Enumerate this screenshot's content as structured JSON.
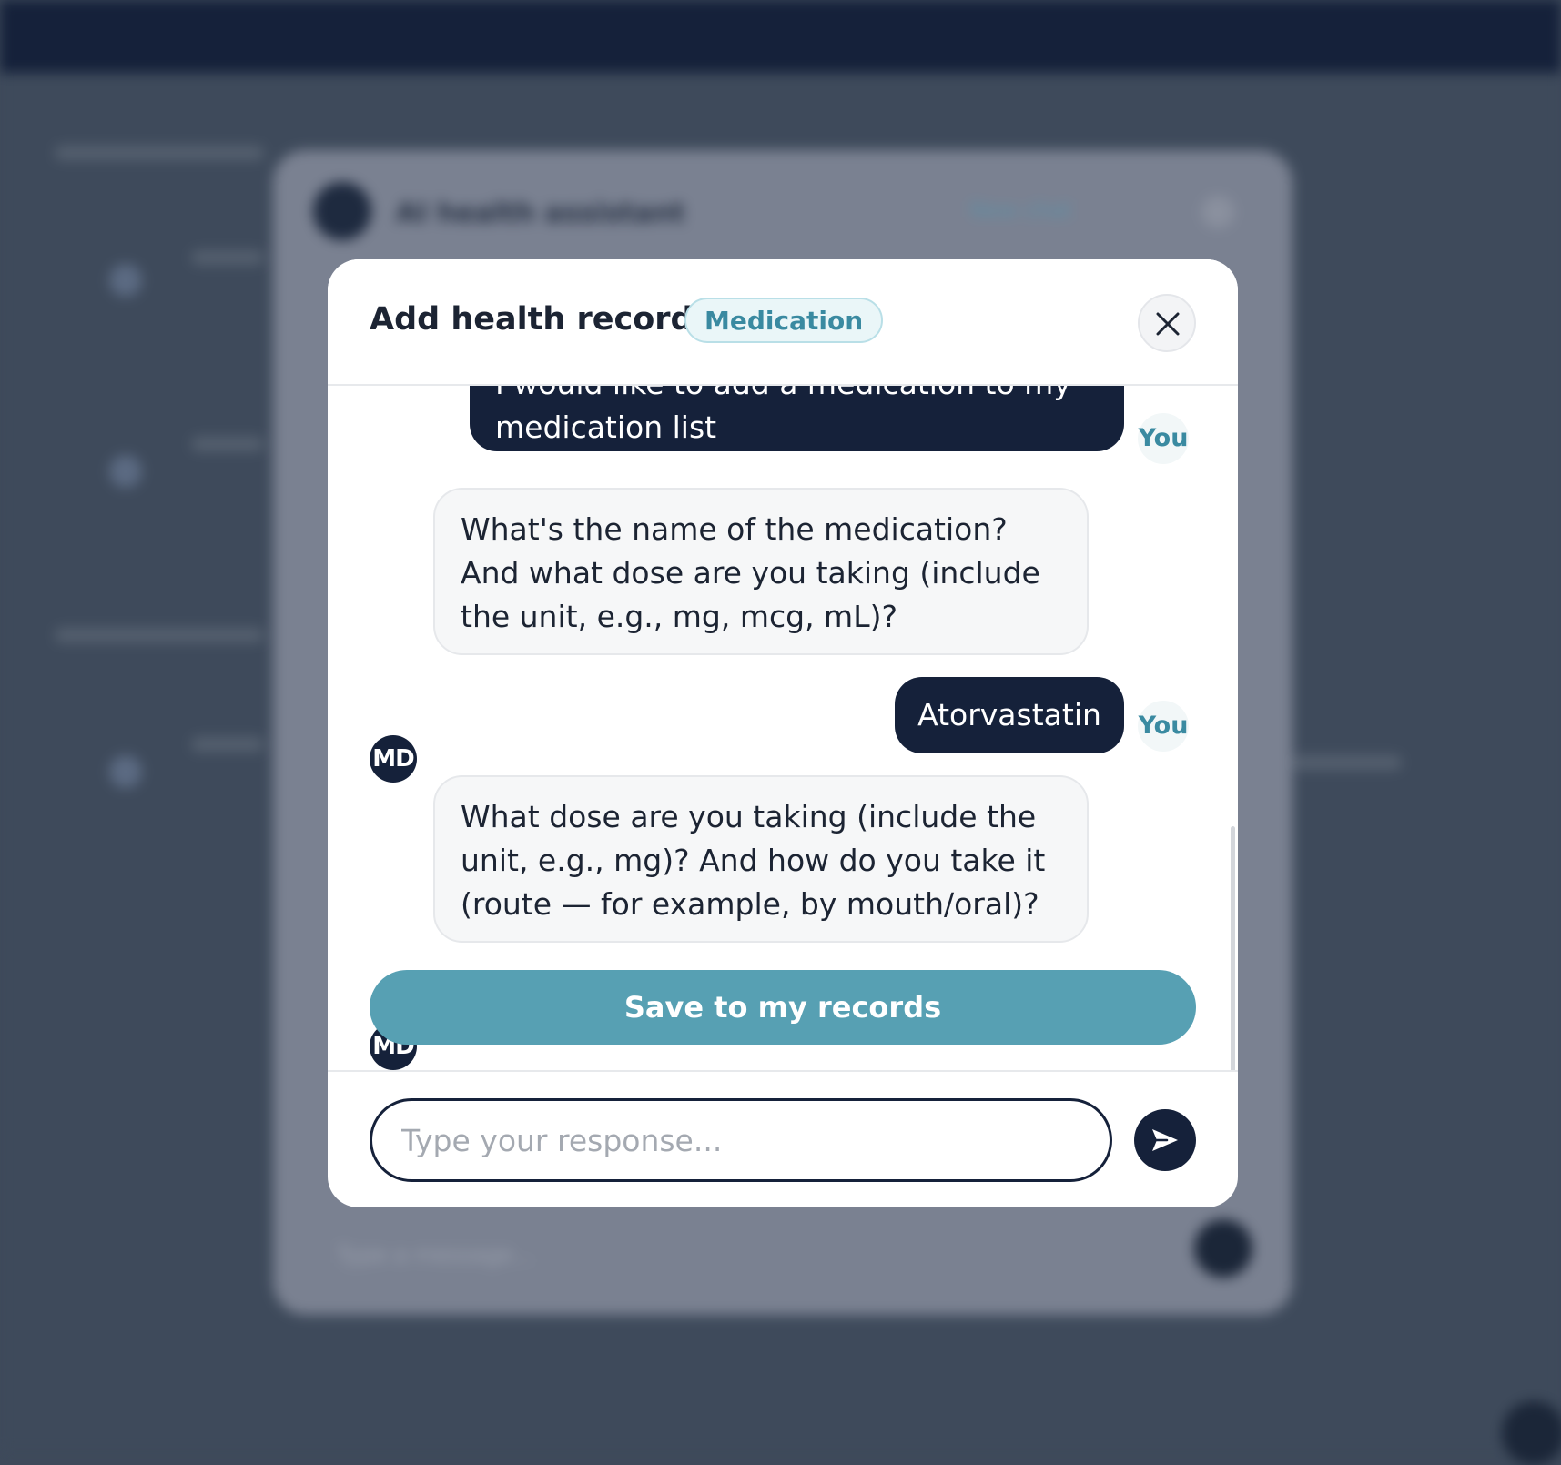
{
  "modal": {
    "title": "Add health record",
    "tag": "Medication",
    "save_label": "Save to my records",
    "input_placeholder": "Type your response..."
  },
  "messages": [
    {
      "sender": "user",
      "badge": "You",
      "text": "I would like to add a medication to my medication list"
    },
    {
      "sender": "assistant",
      "avatar": "MD",
      "text": "What's the name of the medication? And what dose are you taking (include the unit, e.g., mg, mcg, mL)?"
    },
    {
      "sender": "user",
      "badge": "You",
      "text": "Atorvastatin"
    },
    {
      "sender": "assistant",
      "avatar": "MD",
      "text": "What dose are you taking (include the unit, e.g., mg)? And how do you take it (route — for example, by mouth/oral)?"
    }
  ],
  "background": {
    "panel_title": "AI health assistant",
    "new_chat_label": "New chat",
    "input_placeholder": "Type a message..."
  },
  "icons": {
    "close": "close-icon",
    "send": "send-icon"
  },
  "colors": {
    "navy": "#15213a",
    "accent": "#57a0b3",
    "tag_text": "#3a8aa1"
  }
}
